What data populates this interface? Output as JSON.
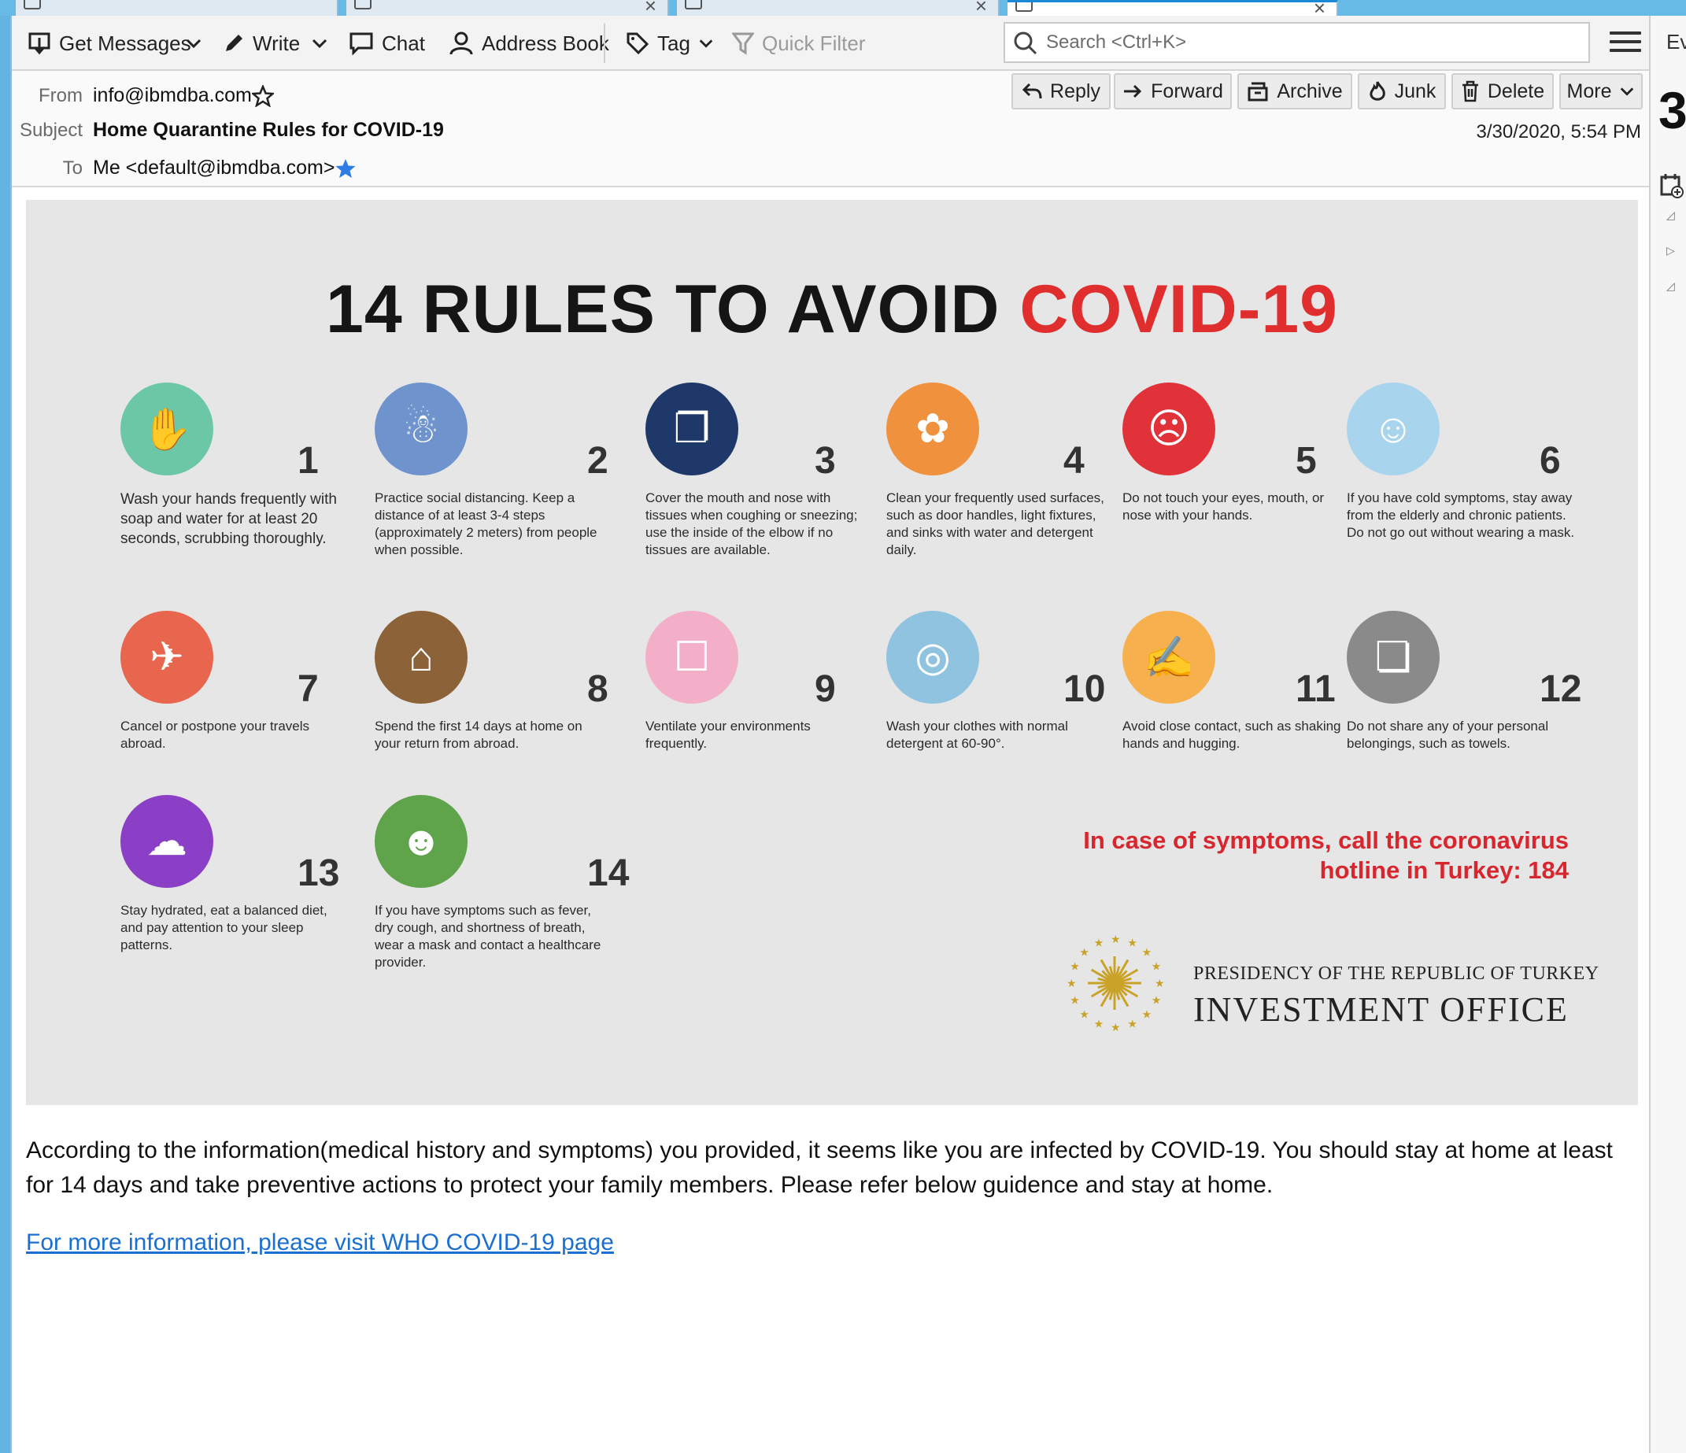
{
  "toolbar": {
    "get_messages": "Get Messages",
    "write": "Write",
    "chat": "Chat",
    "address_book": "Address Book",
    "tag": "Tag",
    "quick_filter": "Quick Filter",
    "search_placeholder": "Search <Ctrl+K>"
  },
  "right_pane": {
    "label": "Ev",
    "day": "3"
  },
  "header": {
    "from_label": "From",
    "from_value": "info@ibmdba.com",
    "subject_label": "Subject",
    "subject_value": "Home Quarantine Rules for COVID-19",
    "to_label": "To",
    "to_value": "Me <default@ibmdba.com>",
    "date": "3/30/2020, 5:54 PM",
    "actions": {
      "reply": "Reply",
      "forward": "Forward",
      "archive": "Archive",
      "junk": "Junk",
      "delete": "Delete",
      "more": "More"
    }
  },
  "infographic": {
    "title_main": "14 RULES TO AVOID ",
    "title_red": "COVID-19",
    "rules": [
      {
        "num": "1",
        "text": "Wash your hands frequently with soap and water for at least 20 seconds, scrubbing thoroughly.",
        "color": "#6cc7a6"
      },
      {
        "num": "2",
        "text": "Practice social distancing. Keep a distance of at least 3-4 steps (approximately 2 meters) from people when possible.",
        "color": "#6f93cd"
      },
      {
        "num": "3",
        "text": "Cover the mouth and nose with tissues when coughing or sneezing; use the inside of the elbow if no tissues are available.",
        "color": "#1e3969"
      },
      {
        "num": "4",
        "text": "Clean your frequently used surfaces, such as door handles, light fixtures, and sinks with water and detergent daily.",
        "color": "#f0913e"
      },
      {
        "num": "5",
        "text": "Do not touch your eyes, mouth, or nose with your hands.",
        "color": "#e1323a"
      },
      {
        "num": "6",
        "text": "If you have cold symptoms, stay away from the elderly and chronic patients. Do not go out without wearing a mask.",
        "color": "#a9d4ee"
      },
      {
        "num": "7",
        "text": "Cancel or postpone your travels abroad.",
        "color": "#e8664e"
      },
      {
        "num": "8",
        "text": "Spend the first 14 days at home on your return from abroad.",
        "color": "#8c6239"
      },
      {
        "num": "9",
        "text": "Ventilate your environments frequently.",
        "color": "#f3afc8"
      },
      {
        "num": "10",
        "text": "Wash your clothes with normal detergent at 60-90°.",
        "color": "#8fc3df"
      },
      {
        "num": "11",
        "text": "Avoid close contact, such as shaking hands and hugging.",
        "color": "#f6b04e"
      },
      {
        "num": "12",
        "text": "Do not share any of your personal belongings, such as towels.",
        "color": "#8a8a8a"
      },
      {
        "num": "13",
        "text": "Stay hydrated, eat a balanced diet, and pay attention to your sleep patterns.",
        "color": "#8a3fc6"
      },
      {
        "num": "14",
        "text": "If you have symptoms such as fever, dry cough, and shortness of breath, wear a mask and contact a healthcare provider.",
        "color": "#5fa34a"
      }
    ],
    "hotline_1": "In case of symptoms, call the coronavirus",
    "hotline_2": "hotline in Turkey: 184",
    "office_presidency": "PRESIDENCY OF THE REPUBLIC OF TURKEY",
    "office_name": "INVESTMENT OFFICE"
  },
  "body": {
    "paragraph": "According to the information(medical history and symptoms) you provided, it seems like you are infected by COVID-19. You should stay at home at least for 14 days and take preventive actions to protect your family members. Please refer below guidence and stay at home.",
    "link": "For more information, please visit WHO COVID-19 page"
  }
}
